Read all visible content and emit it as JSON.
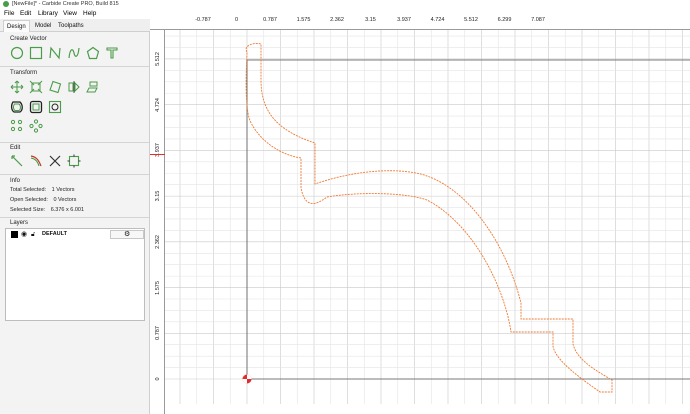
{
  "window": {
    "title": "[NewFile]* - Carbide Create PRO, Build 815"
  },
  "menu": {
    "items": [
      "File",
      "Edit",
      "Library",
      "View",
      "Help"
    ]
  },
  "tabs": [
    {
      "label": "Design",
      "active": true
    },
    {
      "label": "Model",
      "active": false
    },
    {
      "label": "Toolpaths",
      "active": false
    }
  ],
  "sections": {
    "create_vector": "Create Vector",
    "transform": "Transform",
    "edit": "Edit",
    "info": "Info",
    "layers": "Layers"
  },
  "create_vector_tools": [
    "circle-icon",
    "rectangle-icon",
    "polyline-icon",
    "curve-icon",
    "polygon-icon",
    "text-icon"
  ],
  "transform_tools_row1": [
    "move-icon",
    "scale-icon",
    "rotate-icon",
    "mirror-icon",
    "align-icon"
  ],
  "transform_tools_row2": [
    "offset-icon",
    "boolean-icon",
    "group-icon"
  ],
  "transform_tools_row3": [
    "array-icon",
    "circular-array-icon"
  ],
  "edit_tools": [
    "node-edit-icon",
    "trim-icon",
    "cut-icon",
    "join-icon"
  ],
  "info": {
    "total_selected_label": "Total Selected:",
    "total_selected_value": "1 Vectors",
    "open_selected_label": "Open Selected:",
    "open_selected_value": "0 Vectors",
    "selected_size_label": "Selected Size:",
    "selected_size_value": "6.376 x 6.001"
  },
  "layers": [
    {
      "name": "DEFAULT",
      "color": "#000000"
    }
  ],
  "ruler": {
    "x_labels": [
      "-0.787",
      "0",
      "0.787",
      "1.575",
      "2.362",
      "3.15",
      "3.937",
      "4.724",
      "5.512",
      "6.299",
      "7.087"
    ],
    "y_labels": [
      "5.512",
      "4.724",
      "3.937",
      "3.15",
      "2.362",
      "1.575",
      "0.787",
      "0"
    ]
  },
  "colors": {
    "accent": "#4a9b4a",
    "vector": "#f07a30",
    "grid_minor": "#e4e4e4",
    "grid_major": "#c9c9c9",
    "origin": "#e52b2b"
  }
}
